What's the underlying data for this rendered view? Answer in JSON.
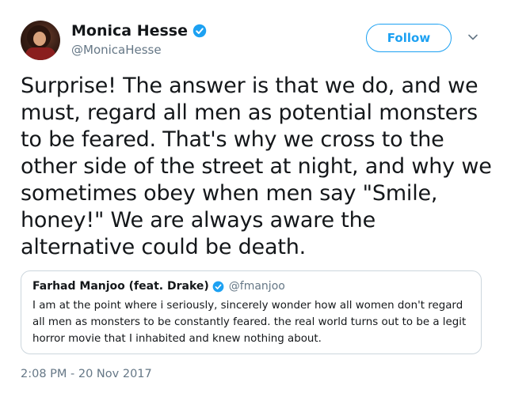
{
  "author": {
    "name": "Monica Hesse",
    "handle": "@MonicaHesse"
  },
  "follow_label": "Follow",
  "tweet": {
    "text": "Surprise! The answer is that we do, and we must, regard all men as potential monsters to be feared. That's why we cross to the other side of the street at night, and why we sometimes obey when men say \"Smile, honey!\" We are always aware the alternative could be death."
  },
  "quoted": {
    "name": "Farhad Manjoo (feat. Drake)",
    "handle": "@fmanjoo",
    "text": "I am at the point where i seriously, sincerely wonder how all women don't regard all men as monsters to be constantly feared. the real world turns out to be a legit horror movie that I inhabited and knew nothing about."
  },
  "timestamp": "2:08 PM - 20 Nov 2017",
  "icons": {
    "verified": "verified-badge-icon",
    "more": "chevron-down-icon"
  },
  "colors": {
    "accent": "#1da1f2",
    "secondary_text": "#657786",
    "border": "#ccd6dd"
  }
}
